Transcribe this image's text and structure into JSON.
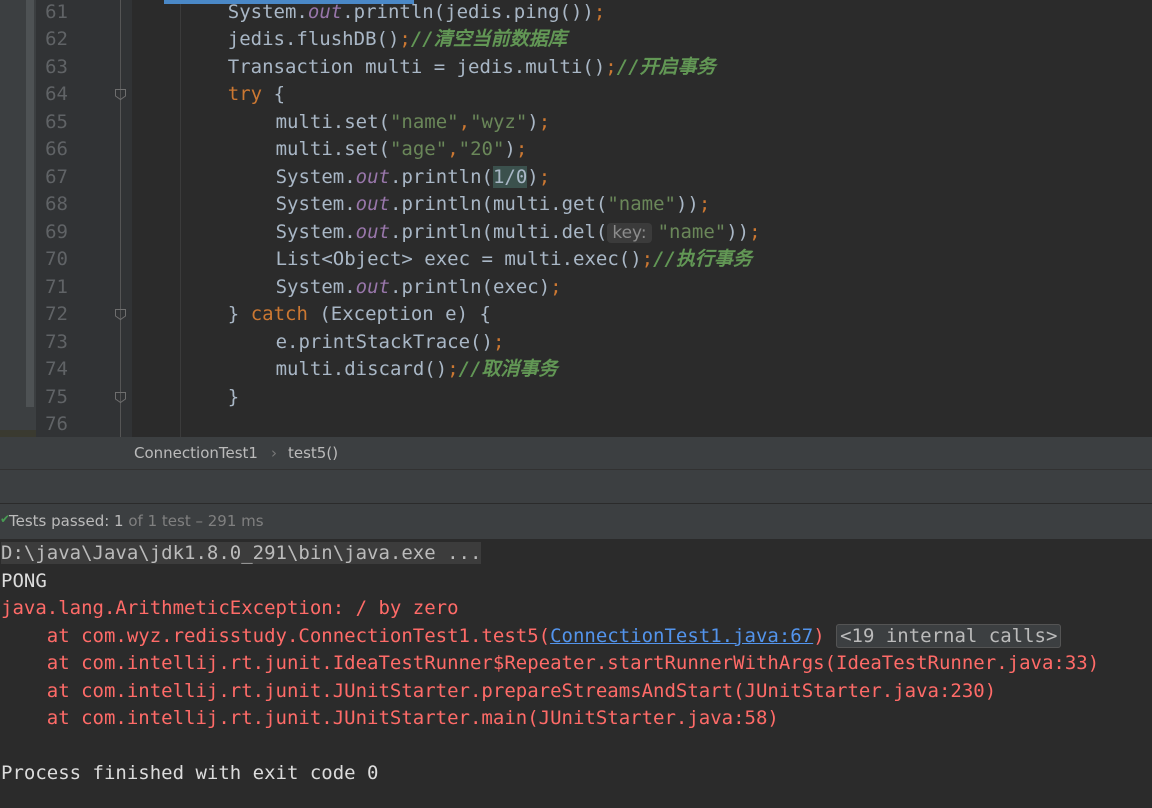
{
  "editor": {
    "lines": [
      {
        "num": "61",
        "indent": 1,
        "tokens": [
          [
            "t",
            "System."
          ],
          [
            "fld",
            "out"
          ],
          [
            "t",
            ".println(jedis.ping())"
          ],
          [
            "kw",
            ";"
          ]
        ]
      },
      {
        "num": "62",
        "indent": 1,
        "tokens": [
          [
            "t",
            "jedis.flushDB()"
          ],
          [
            "kw",
            ";"
          ],
          [
            "cmt",
            "//清空当前数据库"
          ]
        ]
      },
      {
        "num": "63",
        "indent": 1,
        "tokens": [
          [
            "t",
            "Transaction multi = jedis.multi()"
          ],
          [
            "kw",
            ";"
          ],
          [
            "cmt",
            "//开启事务"
          ]
        ]
      },
      {
        "num": "64",
        "indent": 1,
        "fold": true,
        "tokens": [
          [
            "kw",
            "try "
          ],
          [
            "t",
            "{"
          ]
        ]
      },
      {
        "num": "65",
        "indent": 2,
        "tokens": [
          [
            "t",
            "multi.set("
          ],
          [
            "str",
            "\"name\""
          ],
          [
            "kw",
            ","
          ],
          [
            "str",
            "\"wyz\""
          ],
          [
            "t",
            ")"
          ],
          [
            "kw",
            ";"
          ]
        ]
      },
      {
        "num": "66",
        "indent": 2,
        "tokens": [
          [
            "t",
            "multi.set("
          ],
          [
            "str",
            "\"age\""
          ],
          [
            "kw",
            ","
          ],
          [
            "str",
            "\"20\""
          ],
          [
            "t",
            ")"
          ],
          [
            "kw",
            ";"
          ]
        ]
      },
      {
        "num": "67",
        "indent": 2,
        "tokens": [
          [
            "t",
            "System."
          ],
          [
            "fld",
            "out"
          ],
          [
            "t",
            ".println("
          ],
          [
            "sel",
            "1/0"
          ],
          [
            "t",
            ")"
          ],
          [
            "kw",
            ";"
          ]
        ]
      },
      {
        "num": "68",
        "indent": 2,
        "tokens": [
          [
            "t",
            "System."
          ],
          [
            "fld",
            "out"
          ],
          [
            "t",
            ".println(multi.get("
          ],
          [
            "str",
            "\"name\""
          ],
          [
            "t",
            "))"
          ],
          [
            "kw",
            ";"
          ]
        ]
      },
      {
        "num": "69",
        "indent": 2,
        "tokens": [
          [
            "t",
            "System."
          ],
          [
            "fld",
            "out"
          ],
          [
            "t",
            ".println(multi.del("
          ],
          [
            "hint",
            "key:"
          ],
          [
            "str",
            "\"name\""
          ],
          [
            "t",
            "))"
          ],
          [
            "kw",
            ";"
          ]
        ]
      },
      {
        "num": "70",
        "indent": 2,
        "tokens": [
          [
            "t",
            "List<Object> exec = multi.exec()"
          ],
          [
            "kw",
            ";"
          ],
          [
            "cmt",
            "//执行事务"
          ]
        ]
      },
      {
        "num": "71",
        "indent": 2,
        "tokens": [
          [
            "t",
            "System."
          ],
          [
            "fld",
            "out"
          ],
          [
            "t",
            ".println(exec)"
          ],
          [
            "kw",
            ";"
          ]
        ]
      },
      {
        "num": "72",
        "indent": 1,
        "fold": true,
        "tokens": [
          [
            "t",
            "} "
          ],
          [
            "kw",
            "catch "
          ],
          [
            "t",
            "(Exception e) {"
          ]
        ]
      },
      {
        "num": "73",
        "indent": 2,
        "tokens": [
          [
            "t",
            "e.printStackTrace()"
          ],
          [
            "kw",
            ";"
          ]
        ]
      },
      {
        "num": "74",
        "indent": 2,
        "tokens": [
          [
            "t",
            "multi.discard()"
          ],
          [
            "kw",
            ";"
          ],
          [
            "cmt",
            "//取消事务"
          ]
        ]
      },
      {
        "num": "75",
        "indent": 1,
        "fold": true,
        "tokens": [
          [
            "t",
            "}"
          ]
        ]
      },
      {
        "num": "76",
        "indent": 0,
        "tokens": []
      }
    ]
  },
  "breadcrumb": {
    "class_name": "ConnectionTest1",
    "separator": "›",
    "method_name": "test5()"
  },
  "status": {
    "check_icon": "✔",
    "passed_label": "Tests passed: ",
    "passed_count": "1",
    "summary": " of 1 test – 291 ms"
  },
  "console": {
    "lines": [
      {
        "style": "cmd",
        "parts": [
          [
            "plain",
            "D:\\java\\Java\\jdk1.8.0_291\\bin\\java.exe ..."
          ]
        ]
      },
      {
        "style": "out",
        "parts": [
          [
            "plain",
            "PONG"
          ]
        ]
      },
      {
        "style": "err",
        "parts": [
          [
            "plain",
            "java.lang.ArithmeticException: / by zero"
          ]
        ]
      },
      {
        "style": "err",
        "parts": [
          [
            "plain",
            "    at com.wyz.redisstudy.ConnectionTest1.test5("
          ],
          [
            "link",
            "ConnectionTest1.java:67"
          ],
          [
            "plain",
            ") "
          ],
          [
            "folded",
            "<19 internal calls>"
          ]
        ]
      },
      {
        "style": "err",
        "parts": [
          [
            "plain",
            "    at com.intellij.rt.junit.IdeaTestRunner$Repeater.startRunnerWithArgs(IdeaTestRunner.java:33)"
          ]
        ]
      },
      {
        "style": "err",
        "parts": [
          [
            "plain",
            "    at com.intellij.rt.junit.JUnitStarter.prepareStreamsAndStart(JUnitStarter.java:230)"
          ]
        ]
      },
      {
        "style": "err",
        "parts": [
          [
            "plain",
            "    at com.intellij.rt.junit.JUnitStarter.main(JUnitStarter.java:58)"
          ]
        ]
      },
      {
        "style": "out",
        "parts": [
          [
            "plain",
            ""
          ]
        ]
      },
      {
        "style": "out",
        "parts": [
          [
            "plain",
            "Process finished with exit code 0"
          ]
        ]
      }
    ]
  },
  "colors": {
    "background": "#2b2b2b",
    "keyword": "#cc7832",
    "string": "#6a8759",
    "comment": "#629755",
    "field": "#9876aa",
    "error": "#ff6b68",
    "link": "#5394ec",
    "passed": "#499c54"
  }
}
